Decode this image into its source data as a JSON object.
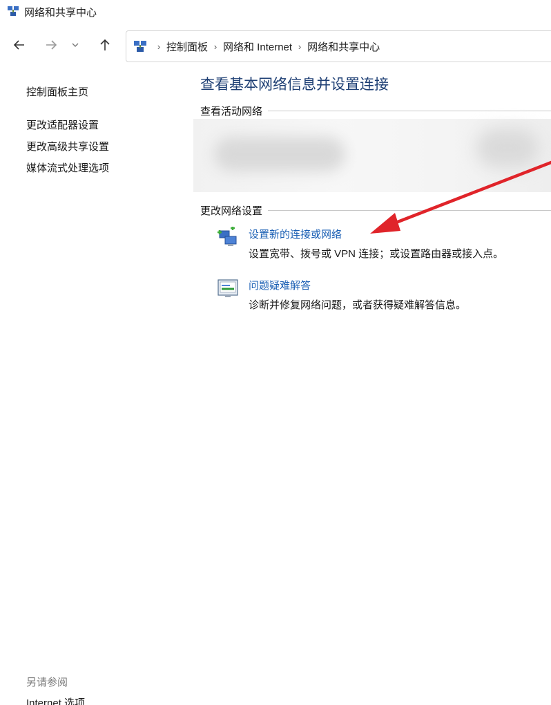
{
  "window": {
    "title": "网络和共享中心"
  },
  "navigation": {
    "breadcrumbs": [
      "控制面板",
      "网络和 Internet",
      "网络和共享中心"
    ]
  },
  "sidebar": {
    "items": [
      {
        "label": "控制面板主页"
      },
      {
        "label": "更改适配器设置"
      },
      {
        "label": "更改高级共享设置"
      },
      {
        "label": "媒体流式处理选项"
      }
    ],
    "see_also_heading": "另请参阅",
    "see_also_items": [
      {
        "label": "Internet 选项"
      }
    ]
  },
  "main": {
    "title": "查看基本网络信息并设置连接",
    "active_networks_heading": "查看活动网络",
    "change_settings_heading": "更改网络设置",
    "tasks": [
      {
        "icon": "network-setup-icon",
        "link": "设置新的连接或网络",
        "description": "设置宽带、拨号或 VPN 连接；或设置路由器或接入点。"
      },
      {
        "icon": "troubleshoot-icon",
        "link": "问题疑难解答",
        "description": "诊断并修复网络问题，或者获得疑难解答信息。"
      }
    ]
  },
  "colors": {
    "title_blue": "#1e3f74",
    "link_blue": "#1a5fb4",
    "annotation_red": "#e0242a"
  }
}
